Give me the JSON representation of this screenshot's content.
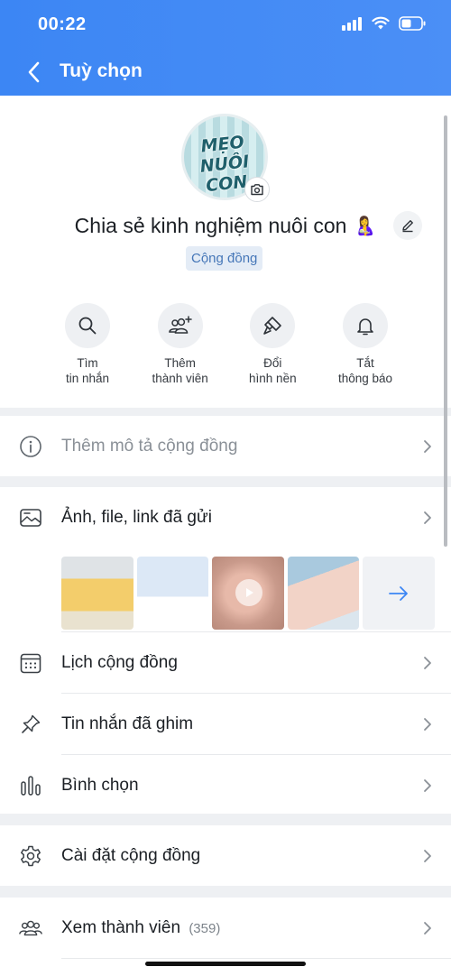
{
  "status_bar": {
    "time": "00:22"
  },
  "nav": {
    "title": "Tuỳ chọn"
  },
  "profile": {
    "avatar_text": "MẸO NUÔI CON",
    "name": "Chia sẻ kinh nghiệm nuôi con",
    "emoji": "🤱",
    "badge": "Cộng đồng"
  },
  "actions": [
    {
      "label": "Tìm\ntin nhắn",
      "icon": "search-icon"
    },
    {
      "label": "Thêm\nthành viên",
      "icon": "add-member-icon"
    },
    {
      "label": "Đổi\nhình nền",
      "icon": "paint-brush-icon"
    },
    {
      "label": "Tắt\nthông báo",
      "icon": "bell-icon"
    }
  ],
  "rows": {
    "description": "Thêm mô tả cộng đồng",
    "media": "Ảnh, file, link đã gửi",
    "calendar": "Lịch cộng đồng",
    "pinned": "Tin nhắn đã ghim",
    "poll": "Bình chọn",
    "settings": "Cài đặt cộng đồng",
    "members": "Xem thành viên",
    "members_count": "(359)"
  },
  "colors": {
    "header": "#3c86f4",
    "accent": "#4677b8"
  }
}
